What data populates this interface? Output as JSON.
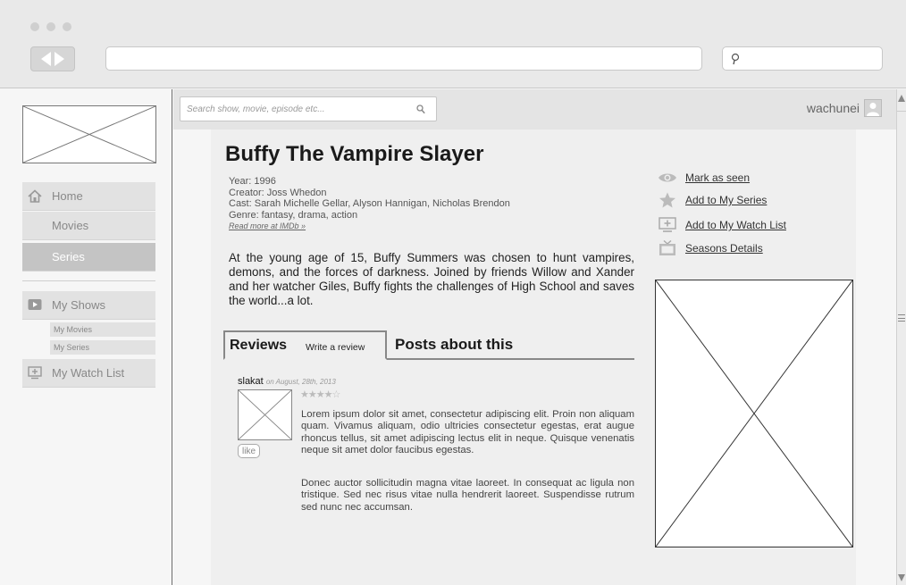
{
  "browser": {
    "url": "",
    "search_value": ""
  },
  "sidebar": {
    "nav": [
      {
        "label": "Home",
        "icon": "home-icon"
      },
      {
        "label": "Movies"
      },
      {
        "label": "Series",
        "active": true
      }
    ],
    "my_shows": {
      "label": "My Shows",
      "icon": "play-icon"
    },
    "sub_items": [
      {
        "label": "My Movies"
      },
      {
        "label": "My Series"
      }
    ],
    "watch_list": {
      "label": "My Watch List",
      "icon": "tv-add-icon"
    }
  },
  "topbar": {
    "search_placeholder": "Search show, movie, episode etc...",
    "username": "wachunei"
  },
  "show": {
    "title": "Buffy The Vampire Slayer",
    "year": "Year: 1996",
    "creator": "Creator: Joss Whedon",
    "cast": "Cast: Sarah Michelle Gellar, Alyson Hannigan, Nicholas Brendon",
    "genre": "Genre: fantasy, drama, action",
    "imdb_link": "Read more at IMDb »",
    "synopsis": "At the young age of 15, Buffy Summers was chosen to hunt vampires, demons, and the forces of darkness. Joined by friends Willow and Xander and her watcher Giles, Buffy fights the challenges of High School and saves the world...a lot."
  },
  "tabs": {
    "reviews": "Reviews",
    "write_review": "Write a review",
    "posts": "Posts about this"
  },
  "review": {
    "author": "slakat",
    "date": "on August, 28th, 2013",
    "rating": 4,
    "rating_max": 5,
    "stars_text": "★★★★☆",
    "like_label": "like",
    "paragraph1": "Lorem ipsum dolor sit amet, consectetur adipiscing elit. Proin non aliquam quam. Vivamus aliquam, odio ultricies consectetur egestas, erat augue rhoncus tellus, sit amet adipiscing lectus elit in neque. Quisque venenatis neque sit amet dolor faucibus egestas.",
    "paragraph2": "Donec auctor sollicitudin magna vitae laoreet. In consequat ac ligula non tristique. Sed nec risus vitae nulla hendrerit laoreet. Suspendisse rutrum sed nunc nec accumsan."
  },
  "actions": [
    {
      "label": "Mark as seen",
      "icon": "eye-icon"
    },
    {
      "label": "Add to My Series",
      "icon": "star-icon"
    },
    {
      "label": "Add to My Watch List",
      "icon": "tv-add-icon"
    },
    {
      "label": "Seasons Details",
      "icon": "tv-icon"
    }
  ],
  "colors": {
    "chrome": "#e9e9e9",
    "panel": "#efefef",
    "active_nav": "#c4c4c4",
    "icon_gray": "#aaaaaa"
  }
}
